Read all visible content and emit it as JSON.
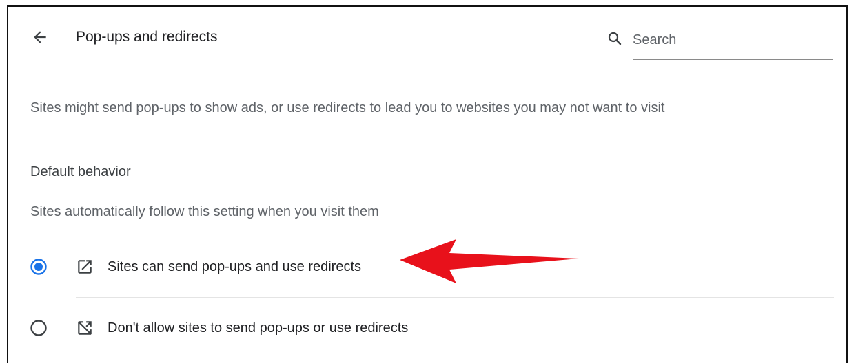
{
  "header": {
    "back_icon": "arrow-left-icon",
    "title": "Pop-ups and redirects",
    "search": {
      "icon": "search-icon",
      "placeholder": "Search",
      "value": ""
    }
  },
  "description": "Sites might send pop-ups to show ads, or use redirects to lead you to websites you may not want to visit",
  "default_behavior": {
    "title": "Default behavior",
    "subtitle": "Sites automatically follow this setting when you visit them",
    "options": [
      {
        "label": "Sites can send pop-ups and use redirects",
        "icon": "open-in-new-icon",
        "selected": true
      },
      {
        "label": "Don't allow sites to send pop-ups or use redirects",
        "icon": "open-in-new-off-icon",
        "selected": false
      }
    ]
  },
  "colors": {
    "accent": "#1a73e8",
    "annotation_arrow": "#e8111b",
    "text_primary": "#202124",
    "text_secondary": "#5f6368"
  }
}
